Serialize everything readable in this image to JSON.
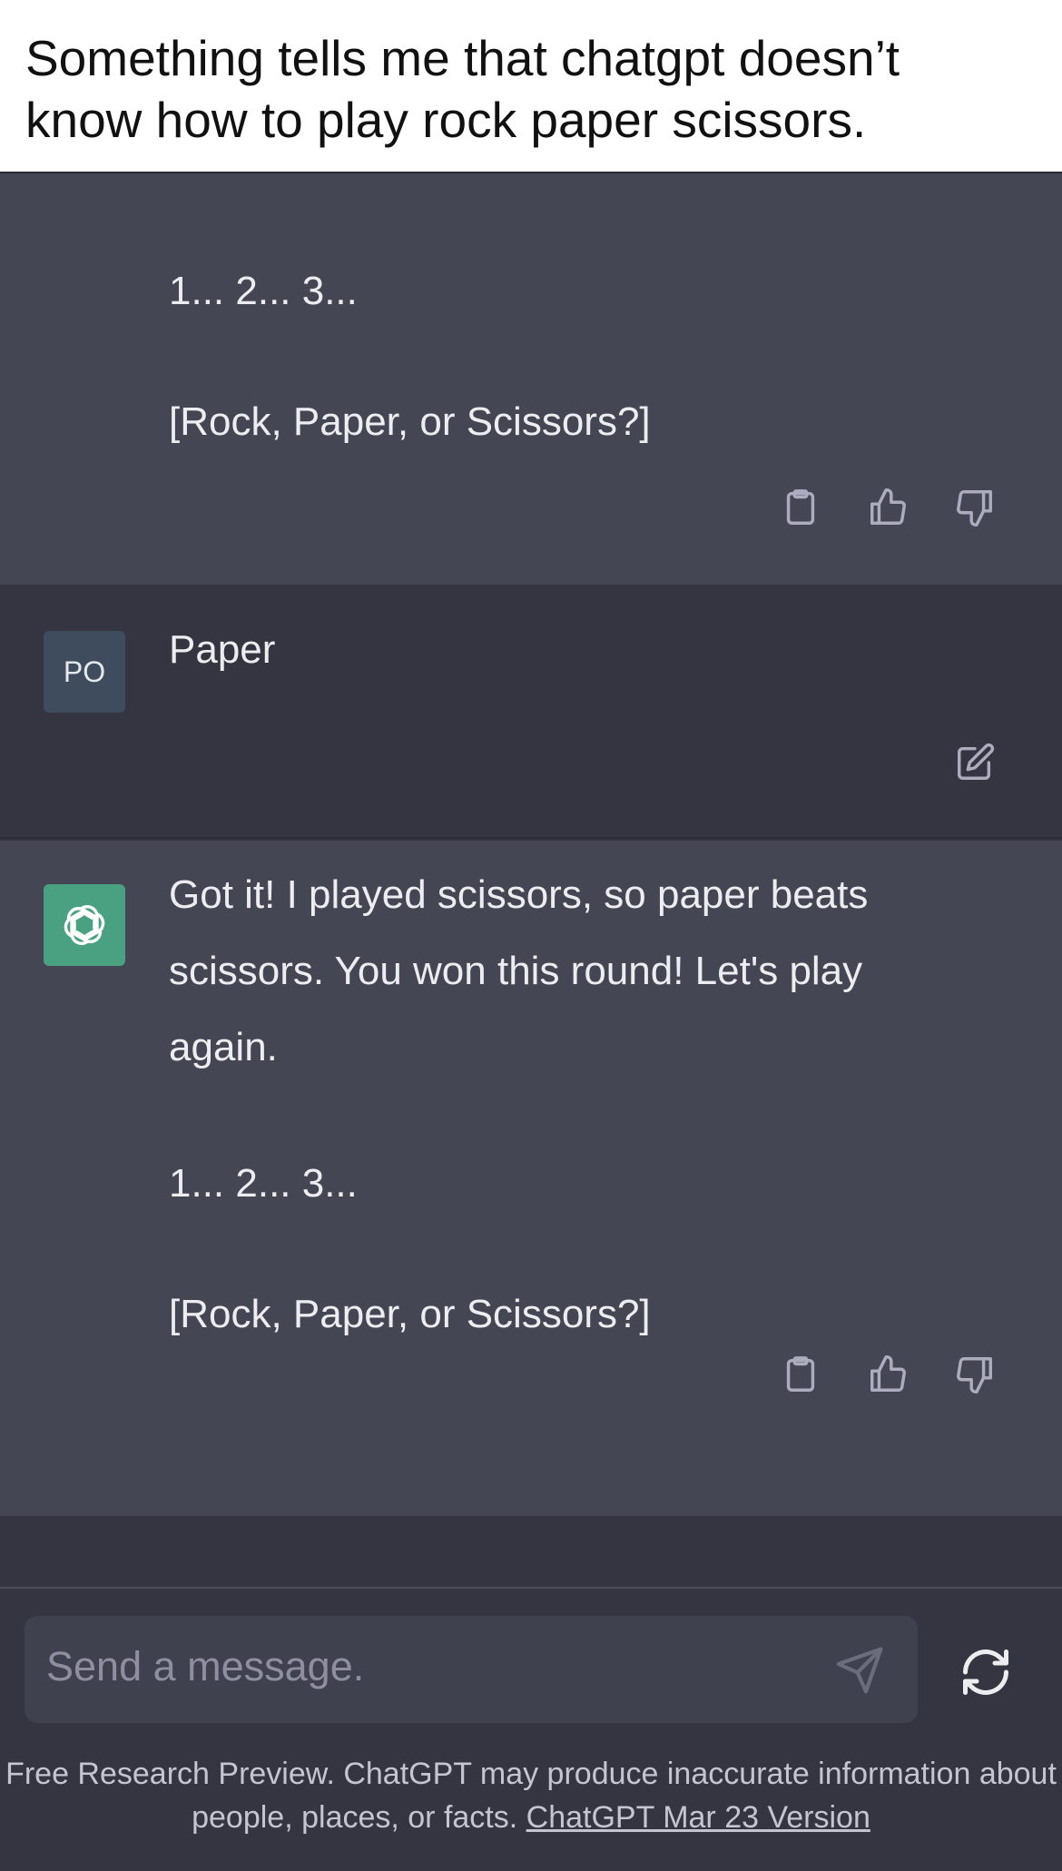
{
  "caption": {
    "line1": "Something tells me that chatgpt doesn’t",
    "line2": "know how to play rock paper scissors."
  },
  "messages": [
    {
      "role": "assistant",
      "lines": [
        "1... 2... 3...",
        "[Rock, Paper, or Scissors?]"
      ],
      "actions": [
        "clipboard-icon",
        "thumbs-up-icon",
        "thumbs-down-icon"
      ]
    },
    {
      "role": "user",
      "avatar_initials": "PO",
      "text": "Paper",
      "actions": [
        "edit-icon"
      ]
    },
    {
      "role": "assistant",
      "paragraph": "Got it! I played scissors, so paper beats scissors. You won this round! Let's play again.",
      "lines": [
        "1... 2... 3...",
        "[Rock, Paper, or Scissors?]"
      ],
      "actions": [
        "clipboard-icon",
        "thumbs-up-icon",
        "thumbs-down-icon"
      ]
    }
  ],
  "composer": {
    "placeholder": "Send a message.",
    "send_icon": "paper-plane-icon",
    "regenerate_icon": "refresh-icon"
  },
  "footer": {
    "text": "Free Research Preview. ChatGPT may produce inaccurate information about people, places, or facts.",
    "link_text": "ChatGPT Mar 23 Version"
  },
  "colors": {
    "assistant_bg": "#444654",
    "user_bg": "#343541",
    "gpt_avatar": "#4aa181",
    "user_avatar": "#3e4c5e",
    "text": "#ececf1"
  }
}
